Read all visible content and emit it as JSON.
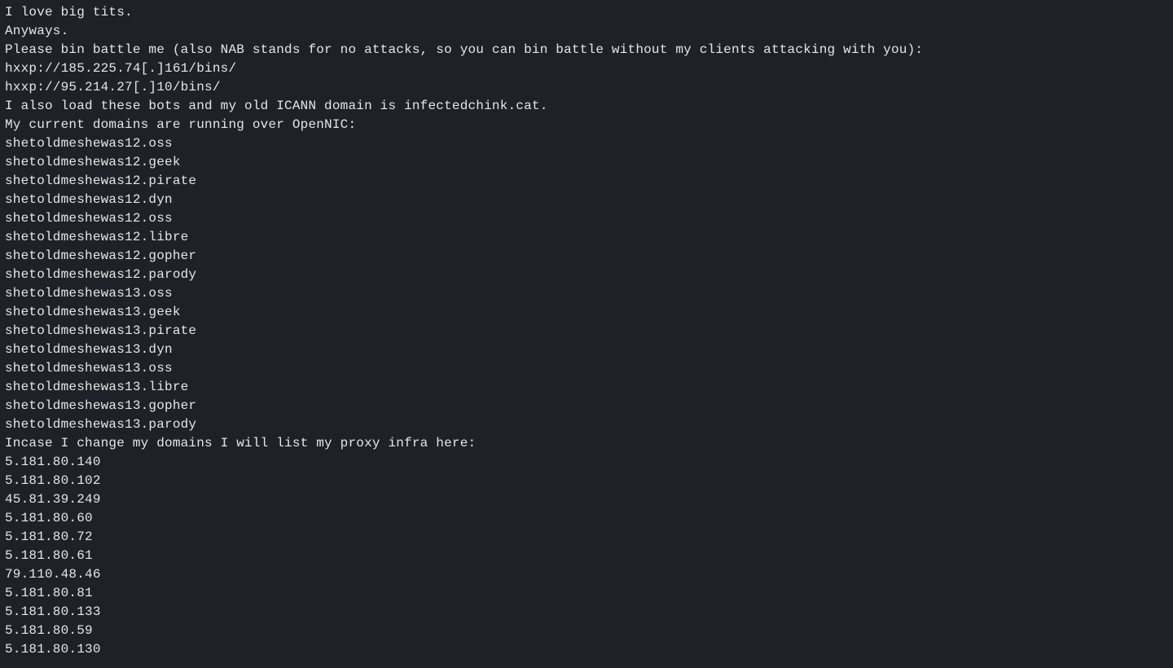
{
  "lines": [
    "I love big tits.",
    "Anyways.",
    "Please bin battle me (also NAB stands for no attacks, so you can bin battle without my clients attacking with you):",
    "hxxp://185.225.74[.]161/bins/",
    "hxxp://95.214.27[.]10/bins/",
    "I also load these bots and my old ICANN domain is infectedchink.cat.",
    "My current domains are running over OpenNIC:",
    "shetoldmeshewas12.oss",
    "shetoldmeshewas12.geek",
    "shetoldmeshewas12.pirate",
    "shetoldmeshewas12.dyn",
    "shetoldmeshewas12.oss",
    "shetoldmeshewas12.libre",
    "shetoldmeshewas12.gopher",
    "shetoldmeshewas12.parody",
    "shetoldmeshewas13.oss",
    "shetoldmeshewas13.geek",
    "shetoldmeshewas13.pirate",
    "shetoldmeshewas13.dyn",
    "shetoldmeshewas13.oss",
    "shetoldmeshewas13.libre",
    "shetoldmeshewas13.gopher",
    "shetoldmeshewas13.parody",
    "Incase I change my domains I will list my proxy infra here:",
    "5.181.80.140",
    "5.181.80.102",
    "45.81.39.249",
    "5.181.80.60",
    "5.181.80.72",
    "5.181.80.61",
    "79.110.48.46",
    "5.181.80.81",
    "5.181.80.133",
    "5.181.80.59",
    "5.181.80.130"
  ]
}
